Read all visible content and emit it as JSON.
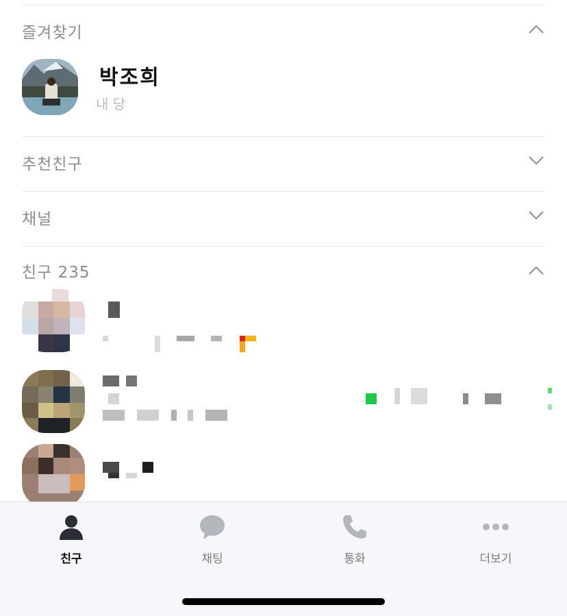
{
  "favorites": {
    "title": "즐겨찾기",
    "contact": {
      "name": "박조희",
      "status": "내 당"
    }
  },
  "recommended": {
    "title": "추천친구"
  },
  "channel": {
    "title": "채널"
  },
  "friends": {
    "title": "친구 235"
  },
  "tabs": [
    {
      "label": "친구",
      "icon": "person-icon",
      "active": true
    },
    {
      "label": "채팅",
      "icon": "chat-bubble-icon",
      "active": false
    },
    {
      "label": "통화",
      "icon": "phone-icon",
      "active": false
    },
    {
      "label": "더보기",
      "icon": "more-dots-icon",
      "active": false
    }
  ],
  "colors": {
    "active_tab": "#2a2d36",
    "inactive_tab": "#b3b6bc",
    "accent_green": "#1ec948",
    "accent_orange": "#f5a623",
    "accent_red": "#d9241b"
  }
}
